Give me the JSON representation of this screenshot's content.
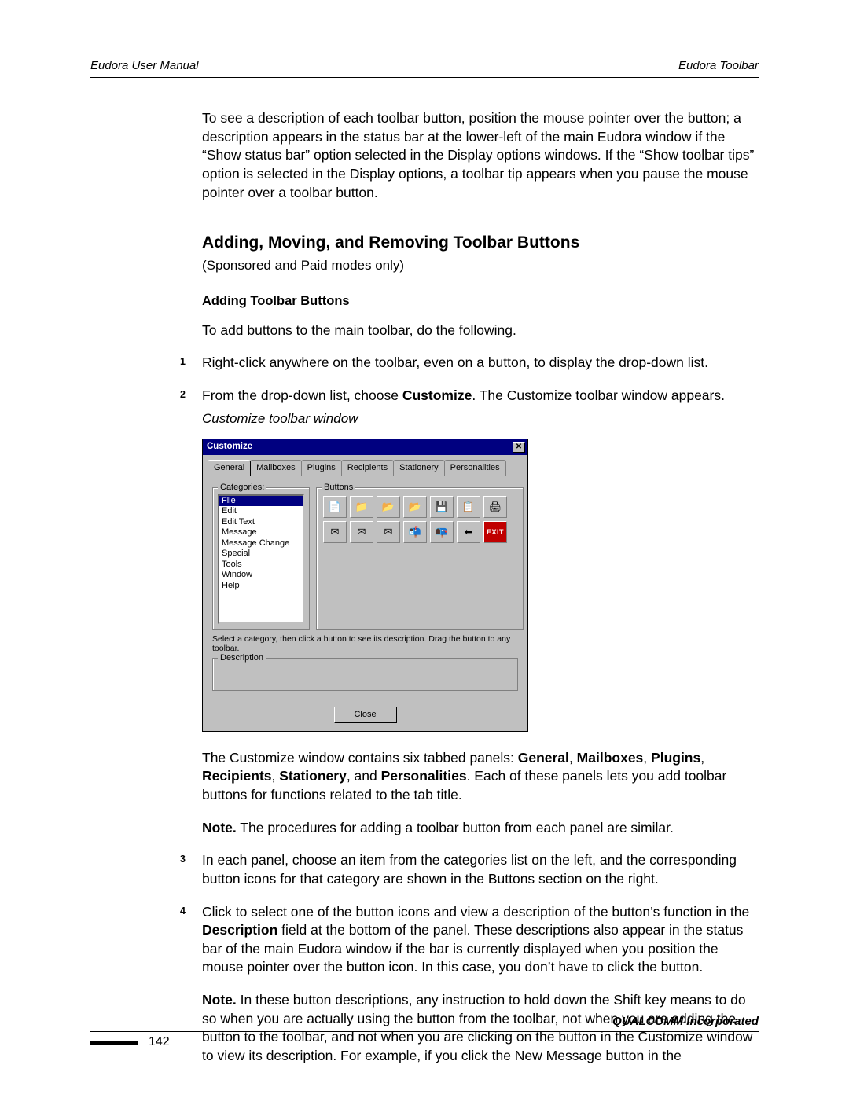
{
  "header": {
    "left": "Eudora User Manual",
    "right": "Eudora Toolbar"
  },
  "intro_paragraph": "To see a description of each toolbar button, position the mouse pointer over the button; a description appears in the status bar at the lower-left of the main Eudora window if the “Show status bar” option selected in the Display options windows. If the “Show toolbar tips” option is selected in the Display options, a toolbar tip appears when you pause the mouse pointer over a toolbar button.",
  "section_heading": "Adding, Moving, and Removing Toolbar Buttons",
  "section_sub": "(Sponsored and Paid modes only)",
  "sub_heading": "Adding Toolbar Buttons",
  "sub_intro": "To add buttons to the main toolbar, do the following.",
  "step1": "Right-click anywhere on the toolbar, even on a button, to display the drop-down list.",
  "step2_a": "From the drop-down list, choose ",
  "step2_b": "Customize",
  "step2_c": ". The Customize toolbar window appears.",
  "caption": "Customize toolbar window",
  "dialog": {
    "title": "Customize",
    "tabs": [
      "General",
      "Mailboxes",
      "Plugins",
      "Recipients",
      "Stationery",
      "Personalities"
    ],
    "categories_label": "Categories:",
    "categories": [
      "File",
      "Edit",
      "Edit Text",
      "Message",
      "Message Change",
      "Special",
      "Tools",
      "Window",
      "Help"
    ],
    "buttons_label": "Buttons",
    "instruction": "Select a category, then click a button to see its description. Drag the button to any toolbar.",
    "description_label": "Description",
    "close": "Close",
    "exit_label": "EXIT"
  },
  "after1_a": "The Customize window contains six tabbed panels: ",
  "after1_panels": [
    "General",
    "Mailboxes",
    "Plugins",
    "Recipients",
    "Stationery",
    "Personalities"
  ],
  "after1_b": ". Each of these panels lets you add toolbar buttons for functions related to the tab title.",
  "note1_label": "Note.",
  "note1_text": " The procedures for adding a toolbar button from each panel are similar.",
  "step3": "In each panel, choose an item from the categories list on the left, and the corresponding button icons for that category are shown in the Buttons section on the right.",
  "step4_a": "Click to select one of the button icons and view a description of the button’s function in the ",
  "step4_b": "Description",
  "step4_c": " field at the bottom of the panel. These descriptions also appear in the status bar of the main Eudora window if the bar is currently displayed when you position the mouse pointer over the button icon. In this case, you don’t have to click the button.",
  "note2_label": "Note.",
  "note2_text": " In these button descriptions, any instruction to hold down the Shift key means to do so when you are actually using the button from the toolbar, not when you are adding the button to the toolbar, and not when you are clicking on the button in the Customize window to view its description. For example, if you click the New Message button in the",
  "footer": {
    "brand": "QUALCOMM Incorporated",
    "page": "142"
  }
}
